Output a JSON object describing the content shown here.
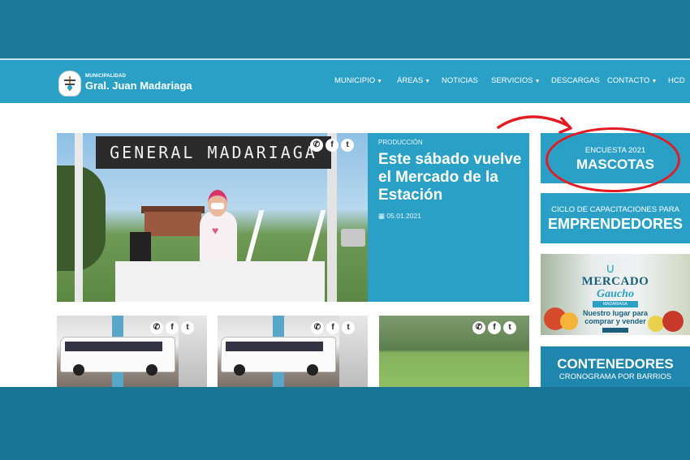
{
  "header": {
    "logo_small": "MUNICIPALIDAD",
    "logo_big": "Gral. Juan Madariaga"
  },
  "nav": {
    "items": [
      {
        "label": "MUNICIPIO",
        "dropdown": true
      },
      {
        "label": "ÁREAS",
        "dropdown": true
      },
      {
        "label": "NOTICIAS",
        "dropdown": false
      },
      {
        "label": "SERVICIOS",
        "dropdown": true
      },
      {
        "label": "DESCARGAS",
        "dropdown": false
      },
      {
        "label": "CONTACTO",
        "dropdown": true
      },
      {
        "label": "HCD",
        "dropdown": false
      }
    ]
  },
  "hero": {
    "sign_text": "GENERAL MADARIAGA",
    "share": {
      "whatsapp": "✆",
      "facebook": "f",
      "twitter": "t"
    }
  },
  "featured": {
    "category": "PRODUCCIÓN",
    "title": "Este sábado vuelve el Mercado de la Estación",
    "date": "05.01.2021",
    "calendar_icon": "▦"
  },
  "sidebar": {
    "encuesta_line1": "ENCUESTA 2021",
    "encuesta_line2": "MASCOTAS",
    "ciclo_line1": "CICLO DE CAPACITACIONES PARA",
    "ciclo_line2": "EMPRENDEDORES",
    "mercado_title": "MERCADO",
    "mercado_subtitle": "Gaucho",
    "mercado_place": "MADARIAGA",
    "mercado_tagline1": "Nuestro lugar para",
    "mercado_tagline2": "comprar y vender",
    "contenedores_line1": "CONTENEDORES",
    "contenedores_line2": "CRONOGRAMA POR BARRIOS"
  },
  "colors": {
    "accent": "#2aa0c6",
    "background": "#1a7494",
    "annotation": "#e31b23"
  }
}
